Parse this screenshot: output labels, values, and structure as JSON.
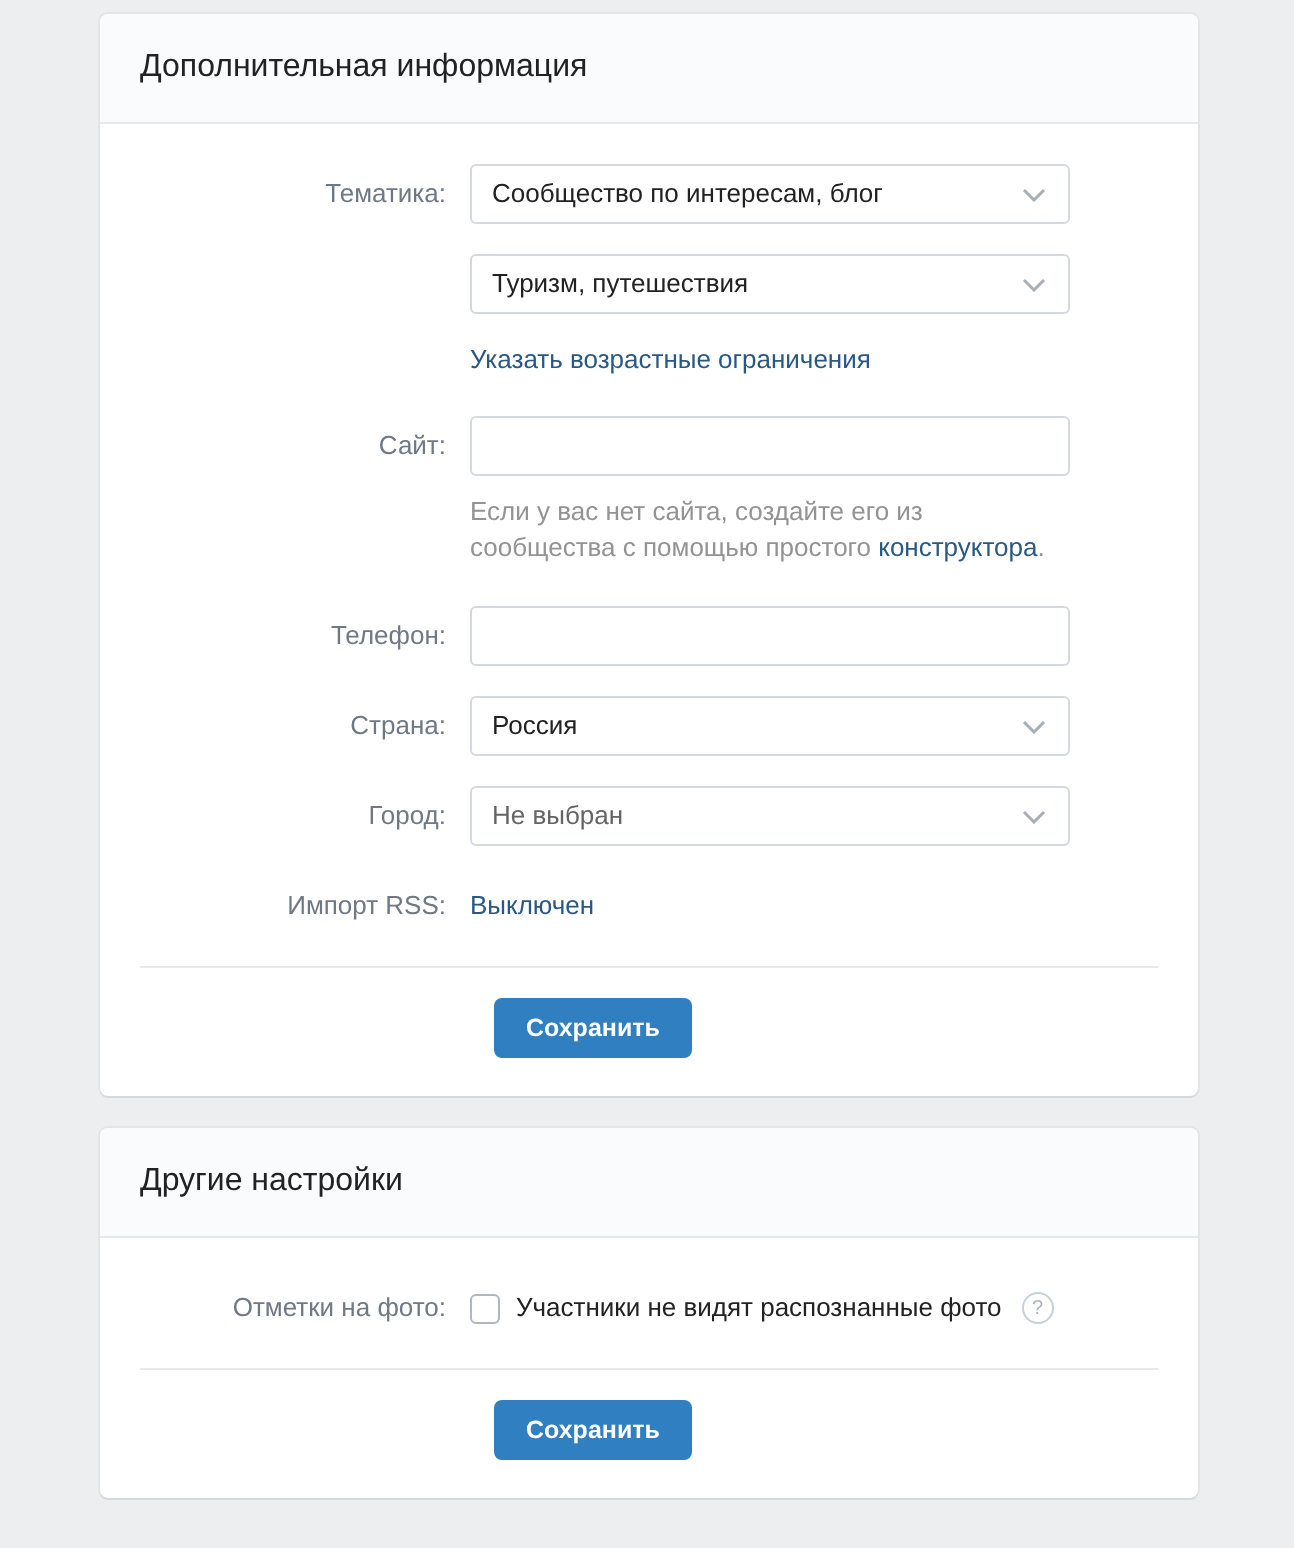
{
  "sections": [
    {
      "title": "Дополнительная информация",
      "rows": [
        {
          "kind": "select",
          "label": "Тематика:",
          "value": "Сообщество по интересам, блог",
          "empty": false
        },
        {
          "kind": "select",
          "value": "Туризм, путешествия",
          "empty": false
        },
        {
          "kind": "link",
          "text": "Указать возрастные ограничения"
        },
        {
          "kind": "input",
          "label": "Сайт:"
        },
        {
          "kind": "hint",
          "text": "Если у вас нет сайта, создайте его из сообщества с помощью простого ",
          "link": "конструктора",
          "after": "."
        },
        {
          "kind": "input",
          "label": "Телефон:"
        },
        {
          "kind": "select",
          "label": "Страна:",
          "value": "Россия",
          "empty": false
        },
        {
          "kind": "select",
          "label": "Город:",
          "value": "Не выбран",
          "empty": true
        },
        {
          "kind": "value_link",
          "label": "Импорт RSS:",
          "text": "Выключен"
        }
      ],
      "button": "Сохранить"
    },
    {
      "title": "Другие настройки",
      "rows": [
        {
          "kind": "checkbox",
          "label": "Отметки на фото:",
          "text": "Участники не видят распознанные фото",
          "checked": false,
          "help": "?"
        }
      ],
      "button": "Сохранить"
    }
  ]
}
